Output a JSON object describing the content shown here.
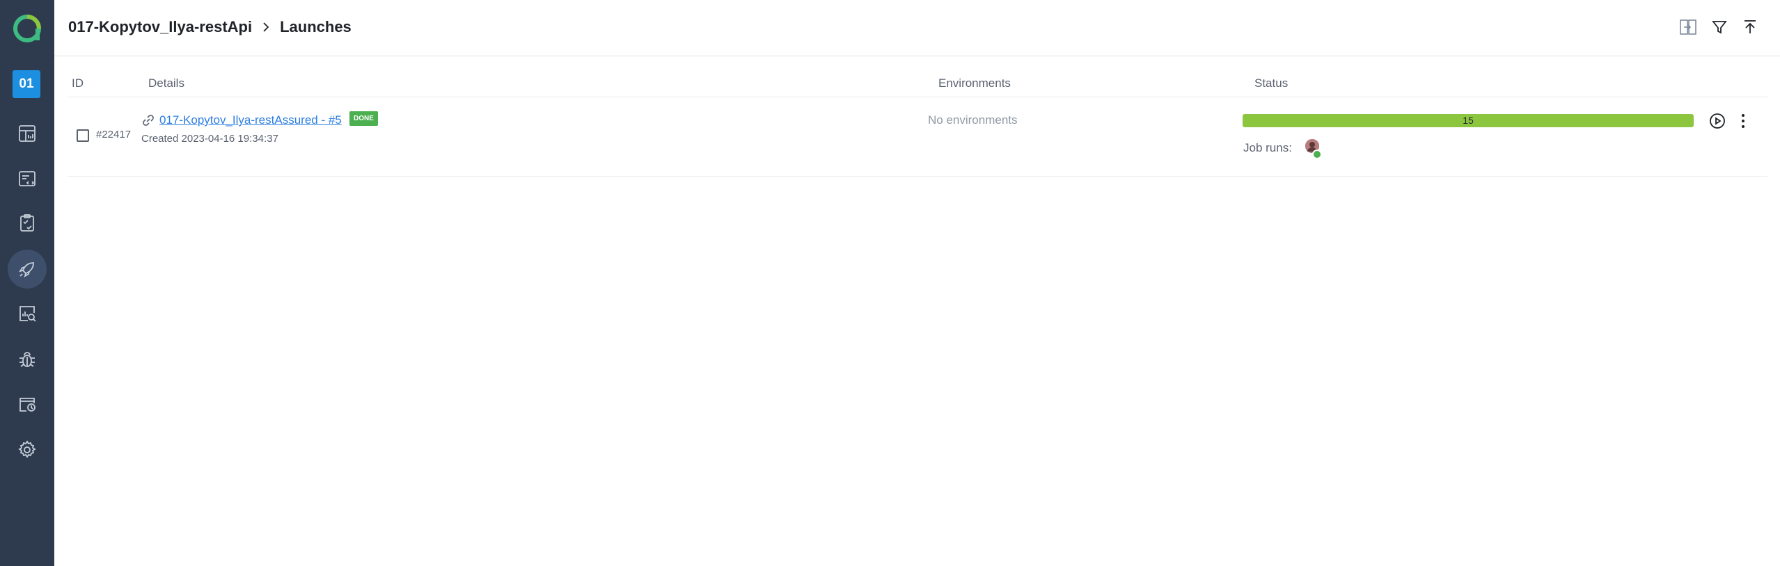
{
  "sidebar": {
    "project_badge": "01",
    "items": [
      {
        "icon": "dashboard-icon",
        "active": false
      },
      {
        "icon": "test-cases-icon",
        "active": false
      },
      {
        "icon": "test-plans-icon",
        "active": false
      },
      {
        "icon": "launches-rocket-icon",
        "active": true
      },
      {
        "icon": "analytics-icon",
        "active": false
      },
      {
        "icon": "defects-bug-icon",
        "active": false
      },
      {
        "icon": "jobs-icon",
        "active": false
      },
      {
        "icon": "settings-gear-icon",
        "active": false
      }
    ]
  },
  "header": {
    "project": "017-Kopytov_Ilya-restApi",
    "page": "Launches",
    "icons": [
      "compare-icon",
      "filter-icon",
      "upload-icon"
    ]
  },
  "table": {
    "columns": {
      "id": "ID",
      "details": "Details",
      "environments": "Environments",
      "status": "Status"
    },
    "rows": [
      {
        "id": "#22417",
        "name": "017-Kopytov_Ilya-restAssured - #5",
        "badge": "DONE",
        "created": "Created 2023-04-16 19:34:37",
        "environments": "No environments",
        "passed": "15",
        "passed_fraction": 1.0,
        "job_runs_label": "Job runs:"
      }
    ]
  },
  "colors": {
    "sidebar": "#2e3b4e",
    "accent": "#1d8fe1",
    "passed": "#8cc63f",
    "done_badge": "#4caf50",
    "link": "#2d7fe0"
  }
}
